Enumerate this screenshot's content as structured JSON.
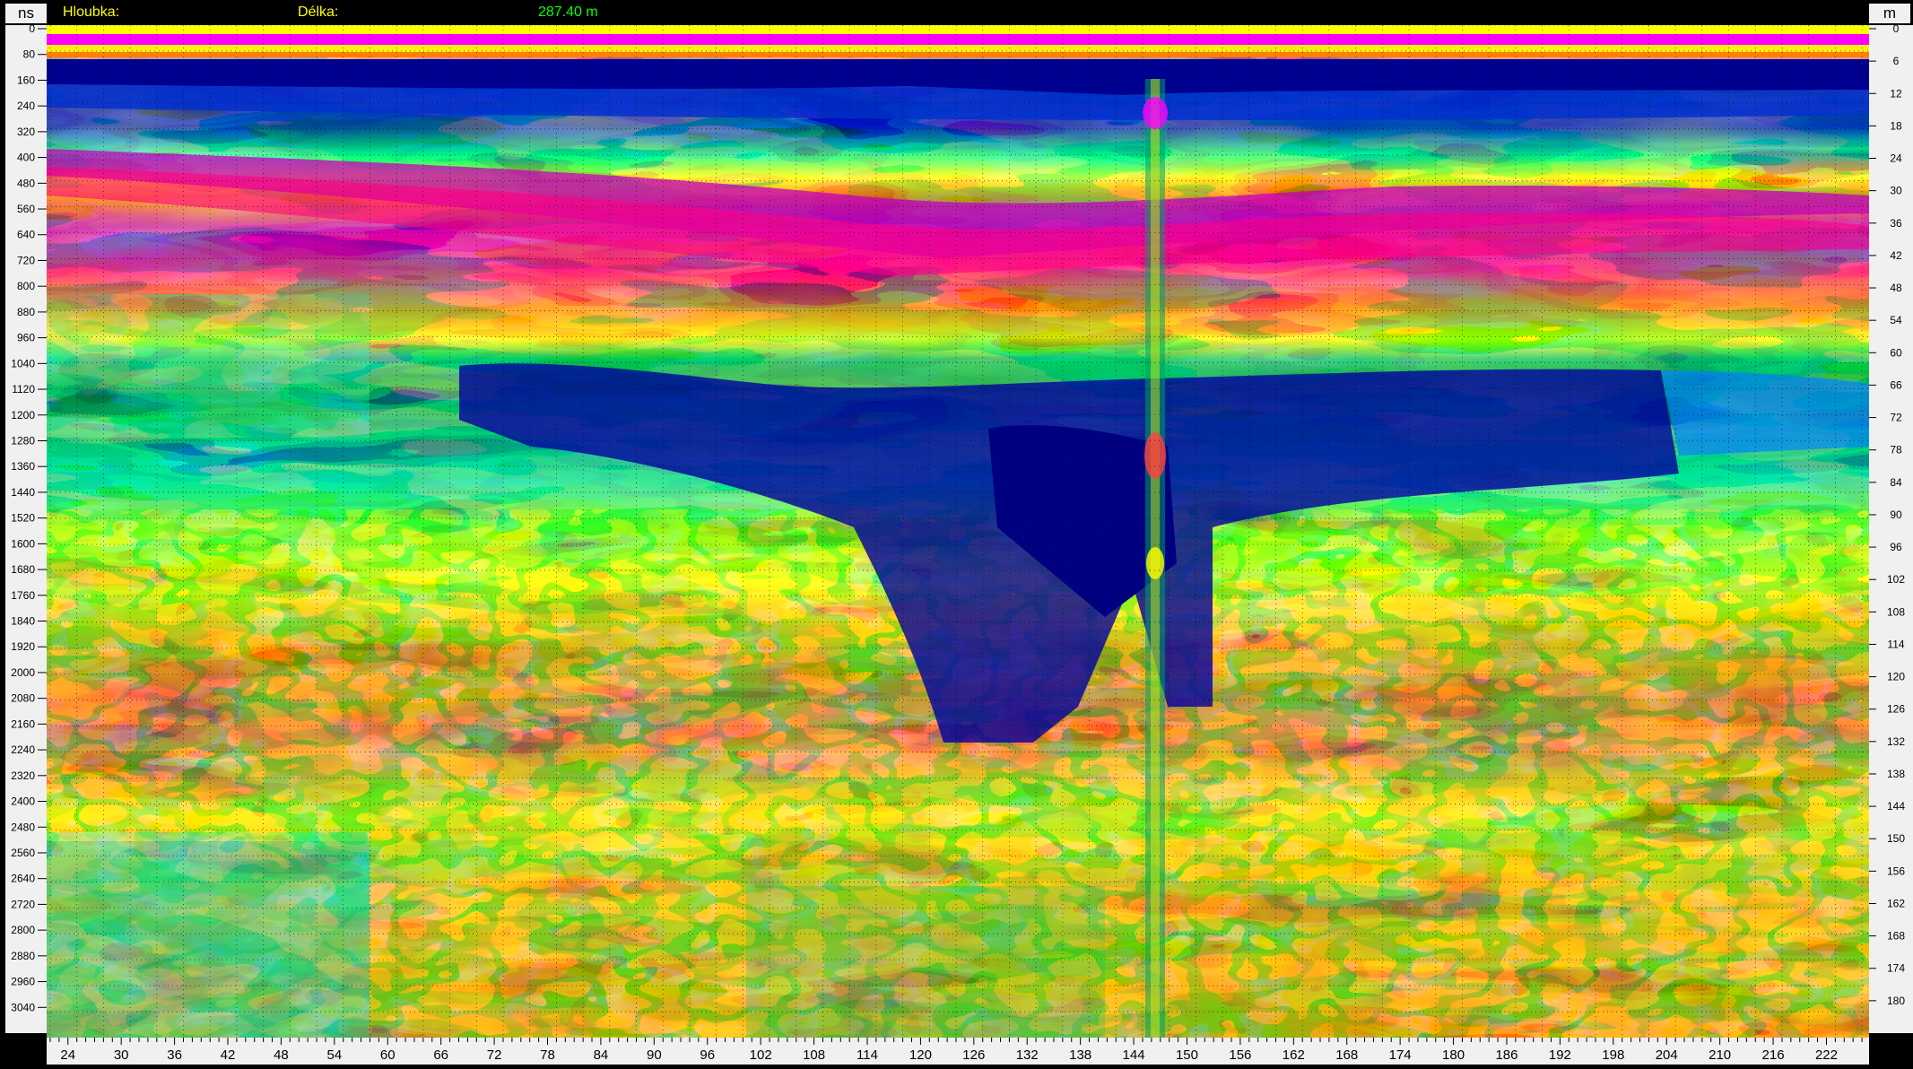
{
  "header": {
    "depth_label": "Hloubka:",
    "length_label": "Délka:",
    "length_value": "287.40 m",
    "left_unit": "ns",
    "right_unit": "m"
  },
  "left_axis": {
    "unit": "ns",
    "ticks": [
      0,
      80,
      160,
      240,
      320,
      400,
      480,
      560,
      640,
      720,
      800,
      880,
      960,
      1040,
      1120,
      1200,
      1280,
      1360,
      1440,
      1520,
      1600,
      1680,
      1760,
      1840,
      1920,
      2000,
      2080,
      2160,
      2240,
      2320,
      2400,
      2480,
      2560,
      2640,
      2720,
      2800,
      2880,
      2960,
      3040
    ],
    "max": 3120
  },
  "right_axis": {
    "unit": "m",
    "ticks": [
      0,
      6,
      12,
      18,
      24,
      30,
      36,
      42,
      48,
      54,
      60,
      66,
      72,
      78,
      84,
      90,
      96,
      102,
      108,
      114,
      120,
      126,
      132,
      138,
      144,
      150,
      156,
      162,
      168,
      174,
      180
    ],
    "max": 186
  },
  "bottom_axis": {
    "ticks": [
      24,
      30,
      36,
      42,
      48,
      54,
      60,
      66,
      72,
      78,
      84,
      90,
      96,
      102,
      108,
      114,
      120,
      126,
      132,
      138,
      144,
      150,
      156,
      162,
      168,
      174,
      180,
      186,
      192,
      198,
      204,
      210,
      216,
      222
    ],
    "min": 21.6,
    "max": 226.8
  },
  "colors": {
    "header_label": "#ffff00",
    "header_value": "#00ff00",
    "axis_bg": "#f0f0f0",
    "grid": "#000000"
  }
}
